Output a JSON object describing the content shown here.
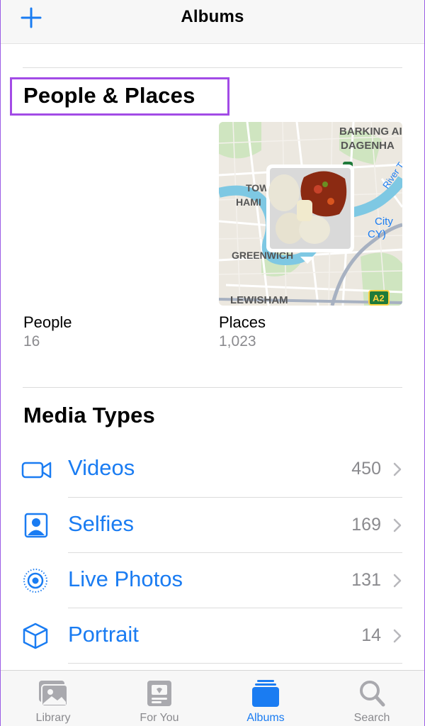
{
  "header": {
    "title": "Albums",
    "add_icon": "plus-icon"
  },
  "people_places": {
    "title": "People & Places",
    "people": {
      "label": "People",
      "count": "16"
    },
    "places": {
      "label": "Places",
      "count": "1,023",
      "map_labels": [
        "BARKING AI",
        "DAGENHA",
        "TOW",
        "HAMI",
        "City",
        "CY)",
        "GREENWICH",
        "LEWISHAM",
        "A2",
        "River T"
      ]
    }
  },
  "media_types": {
    "title": "Media Types",
    "items": [
      {
        "label": "Videos",
        "count": "450",
        "icon": "video-camera-icon"
      },
      {
        "label": "Selfies",
        "count": "169",
        "icon": "selfie-portrait-icon"
      },
      {
        "label": "Live Photos",
        "count": "131",
        "icon": "live-photo-icon"
      },
      {
        "label": "Portrait",
        "count": "14",
        "icon": "portrait-cube-icon"
      }
    ]
  },
  "tabbar": {
    "tabs": [
      {
        "label": "Library",
        "icon": "photos-library-icon",
        "active": false
      },
      {
        "label": "For You",
        "icon": "for-you-icon",
        "active": false
      },
      {
        "label": "Albums",
        "icon": "albums-icon",
        "active": true
      },
      {
        "label": "Search",
        "icon": "search-icon",
        "active": false
      }
    ]
  },
  "colors": {
    "accent": "#1a7cf2",
    "secondary_text": "#8a8a8e",
    "highlight": "#a24be6"
  }
}
